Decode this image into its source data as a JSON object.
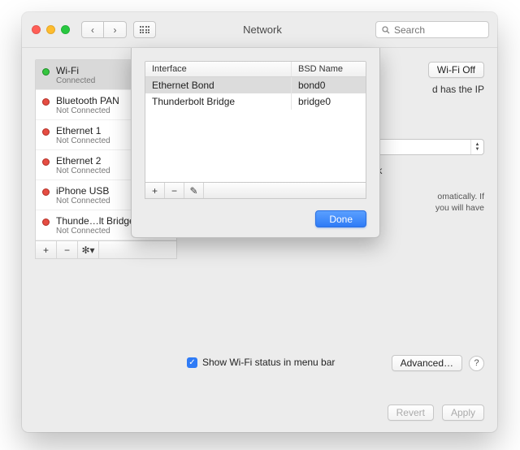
{
  "window": {
    "title": "Network"
  },
  "toolbar": {
    "search_placeholder": "Search"
  },
  "sidebar": {
    "items": [
      {
        "name": "Wi-Fi",
        "status": "Connected",
        "color": "green"
      },
      {
        "name": "Bluetooth PAN",
        "status": "Not Connected",
        "color": "red"
      },
      {
        "name": "Ethernet 1",
        "status": "Not Connected",
        "color": "red"
      },
      {
        "name": "Ethernet 2",
        "status": "Not Connected",
        "color": "red"
      },
      {
        "name": "iPhone USB",
        "status": "Not Connected",
        "color": "red"
      },
      {
        "name": "Thunde…lt Bridge",
        "status": "Not Connected",
        "color": "red"
      }
    ]
  },
  "main": {
    "wifi_off_btn": "Wi-Fi Off",
    "ip_text_tail": "d has the IP",
    "network_label": "work",
    "auto_line1": "omatically. If",
    "auto_line2": "you will have",
    "show_label": "Show Wi-Fi status in menu bar",
    "advanced_btn": "Advanced…"
  },
  "footer": {
    "revert": "Revert",
    "apply": "Apply"
  },
  "sheet": {
    "headers": {
      "interface": "Interface",
      "bsd": "BSD Name"
    },
    "rows": [
      {
        "interface": "Ethernet Bond",
        "bsd": "bond0"
      },
      {
        "interface": "Thunderbolt Bridge",
        "bsd": "bridge0"
      }
    ],
    "done": "Done"
  }
}
